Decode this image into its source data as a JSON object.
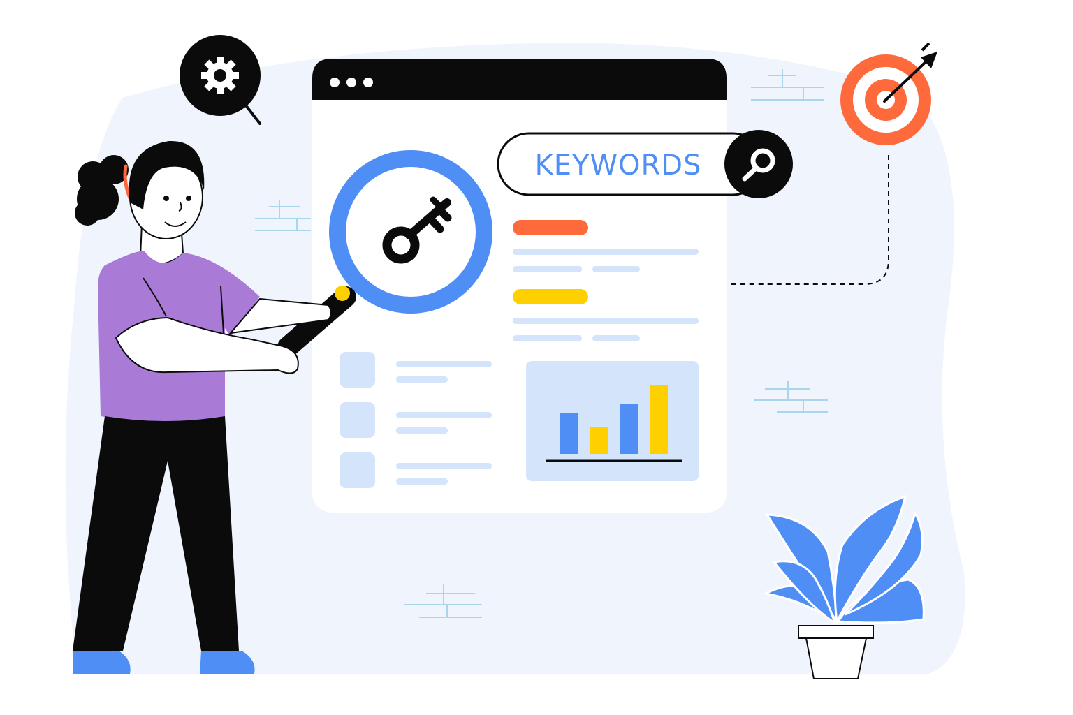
{
  "search": {
    "label": "KEYWORDS",
    "icon": "search-icon"
  },
  "icons": [
    "gear-search-icon",
    "target-icon",
    "key-icon",
    "magnifier-icon",
    "plant-icon",
    "bar-chart-icon"
  ],
  "chart_data": {
    "type": "bar",
    "categories": [
      "",
      "",
      "",
      ""
    ],
    "values": [
      58,
      38,
      72,
      98
    ],
    "colors": [
      "#4f8ff5",
      "#ffd000",
      "#4f8ff5",
      "#ffd000"
    ],
    "ylim": [
      0,
      100
    ],
    "grid": false
  },
  "colors": {
    "accent_blue": "#4f8ff5",
    "accent_orange": "#ff6a3d",
    "accent_yellow": "#ffd000",
    "accent_purple": "#a97bd6",
    "background": "#f0f5fd",
    "light_blue": "#d3e4fb",
    "dark": "#0b0b0b"
  }
}
